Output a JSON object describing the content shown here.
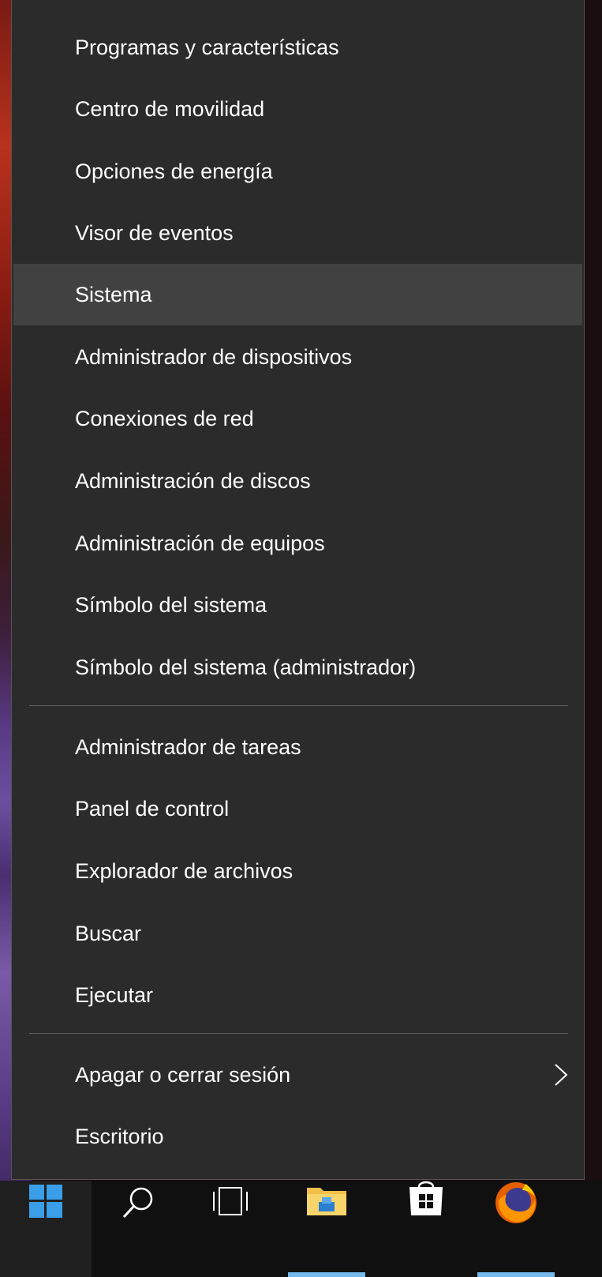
{
  "menu": {
    "items_group1": [
      {
        "label": "Programas y características",
        "hover": false
      },
      {
        "label": "Centro de movilidad",
        "hover": false
      },
      {
        "label": "Opciones de energía",
        "hover": false
      },
      {
        "label": "Visor de eventos",
        "hover": false
      },
      {
        "label": "Sistema",
        "hover": true
      },
      {
        "label": "Administrador de dispositivos",
        "hover": false
      },
      {
        "label": "Conexiones de red",
        "hover": false
      },
      {
        "label": "Administración de discos",
        "hover": false
      },
      {
        "label": "Administración de equipos",
        "hover": false
      },
      {
        "label": "Símbolo del sistema",
        "hover": false
      },
      {
        "label": "Símbolo del sistema (administrador)",
        "hover": false
      }
    ],
    "items_group2": [
      {
        "label": "Administrador de tareas"
      },
      {
        "label": "Panel de control"
      },
      {
        "label": "Explorador de archivos"
      },
      {
        "label": "Buscar"
      },
      {
        "label": "Ejecutar"
      }
    ],
    "items_group3": [
      {
        "label": "Apagar o cerrar sesión",
        "submenu": true
      },
      {
        "label": "Escritorio",
        "submenu": false
      }
    ]
  },
  "taskbar": {
    "buttons": [
      {
        "name": "start",
        "icon": "windows-logo-icon",
        "active": true
      },
      {
        "name": "search",
        "icon": "search-icon",
        "active": false
      },
      {
        "name": "task-view",
        "icon": "task-view-icon",
        "active": false
      },
      {
        "name": "file-explorer",
        "icon": "folder-icon",
        "active": true
      },
      {
        "name": "store",
        "icon": "store-bag-icon",
        "active": false
      },
      {
        "name": "firefox",
        "icon": "firefox-icon",
        "active": true
      }
    ]
  },
  "colors": {
    "menu_bg": "#2b2b2b",
    "hover_bg": "#414141",
    "text": "#ffffff",
    "separator": "#5f5f5f",
    "taskbar_bg": "#101010",
    "accent": "#76b9ed",
    "windows_blue": "#0078d7"
  }
}
